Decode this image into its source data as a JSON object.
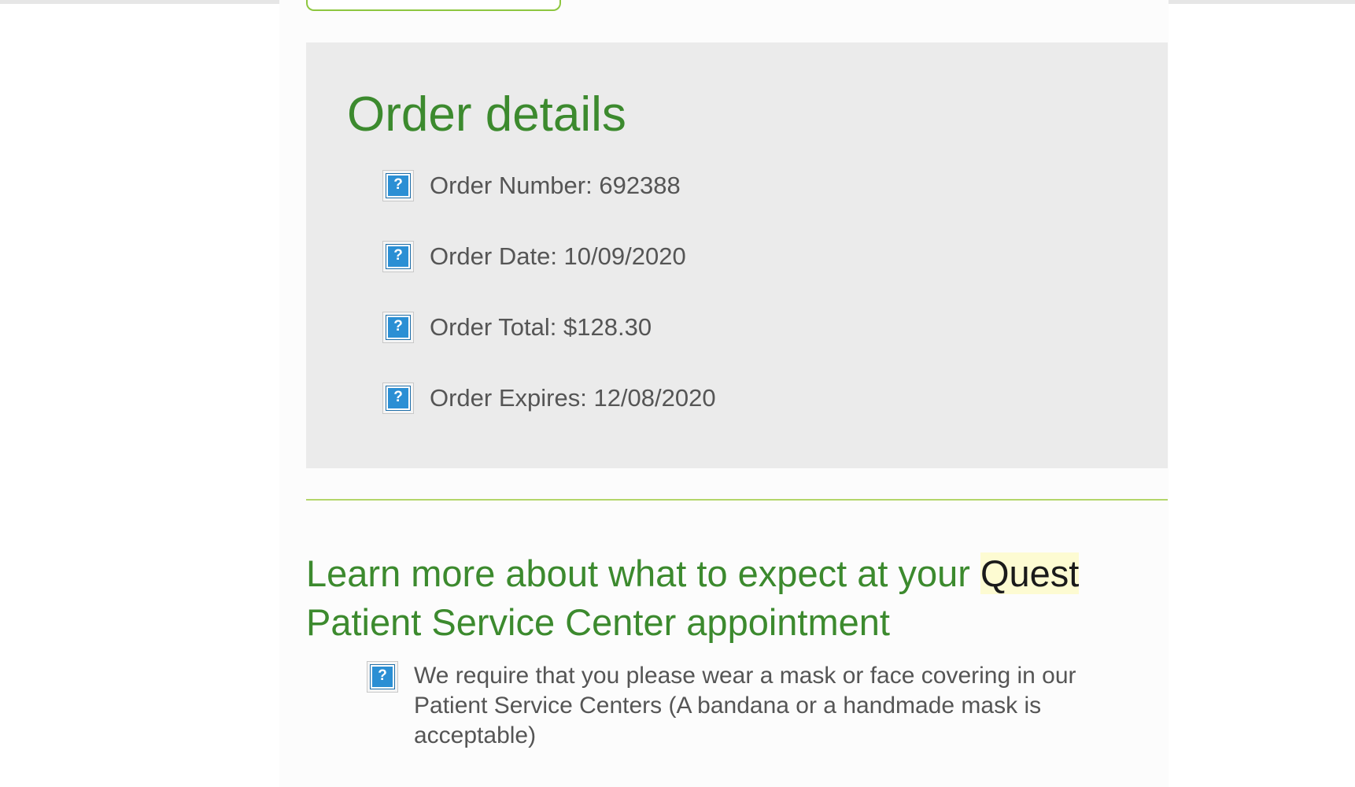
{
  "order_details": {
    "title": "Order details",
    "items": [
      {
        "label": "Order Number: 692388",
        "icon": "help-icon"
      },
      {
        "label": "Order Date: 10/09/2020",
        "icon": "help-icon"
      },
      {
        "label": "Order Total: $128.30",
        "icon": "help-icon"
      },
      {
        "label": "Order Expires: 12/08/2020",
        "icon": "help-icon"
      }
    ]
  },
  "learn_more": {
    "heading_before": "Learn more about what to expect at your ",
    "heading_highlight": "Quest",
    "heading_after": " Patient Service Center appointment",
    "items": [
      {
        "text": "We require that you please wear a mask or face covering in our Patient Service Centers (A bandana or a handmade mask is acceptable)",
        "icon": "help-icon"
      }
    ]
  },
  "icon_glyph": "?",
  "colors": {
    "heading_green": "#3c8a2e",
    "panel_gray": "#ebebeb",
    "divider_green": "#b3d66a",
    "icon_blue": "#2b8fd4",
    "highlight_yellow": "#fdfbd2",
    "body_text": "#555555"
  }
}
